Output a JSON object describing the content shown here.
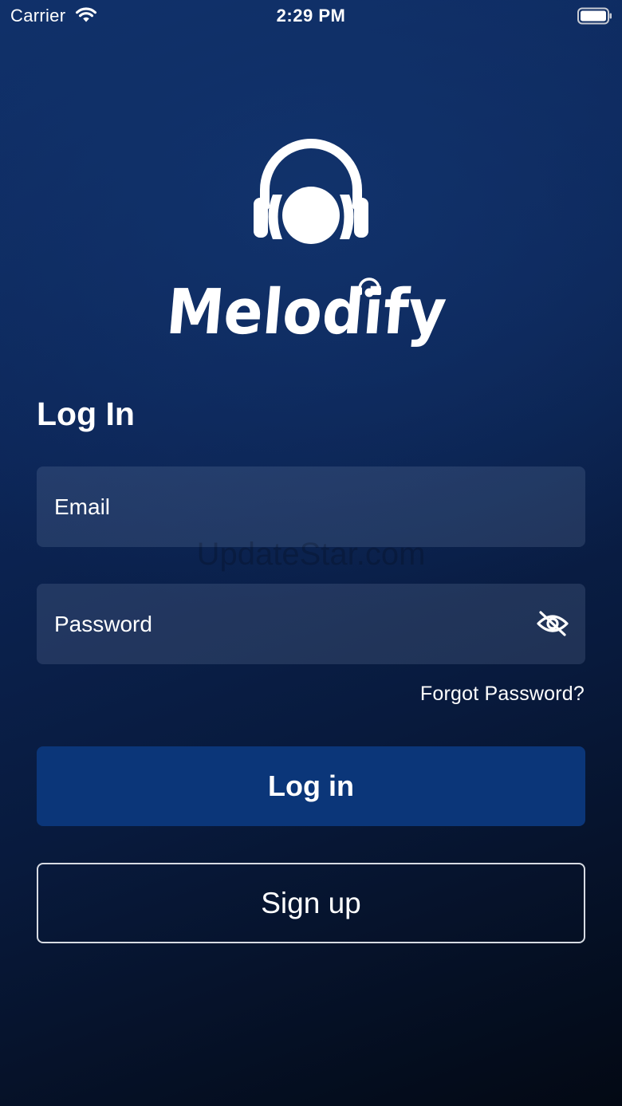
{
  "status_bar": {
    "carrier": "Carrier",
    "time": "2:29 PM",
    "wifi_icon": "wifi-icon",
    "battery_icon": "battery-icon"
  },
  "branding": {
    "app_name": "Melodify",
    "logo_icon": "headphones-icon"
  },
  "login_form": {
    "heading": "Log In",
    "email_placeholder": "Email",
    "password_placeholder": "Password",
    "password_visibility_icon": "eye-off-icon",
    "forgot_password": "Forgot Password?",
    "login_button": "Log in",
    "signup_button": "Sign up"
  },
  "watermark": "UpdateStar.com",
  "colors": {
    "background_top": "#0f2f68",
    "background_bottom": "#030914",
    "primary_button": "#0b3679",
    "text": "#ffffff"
  }
}
